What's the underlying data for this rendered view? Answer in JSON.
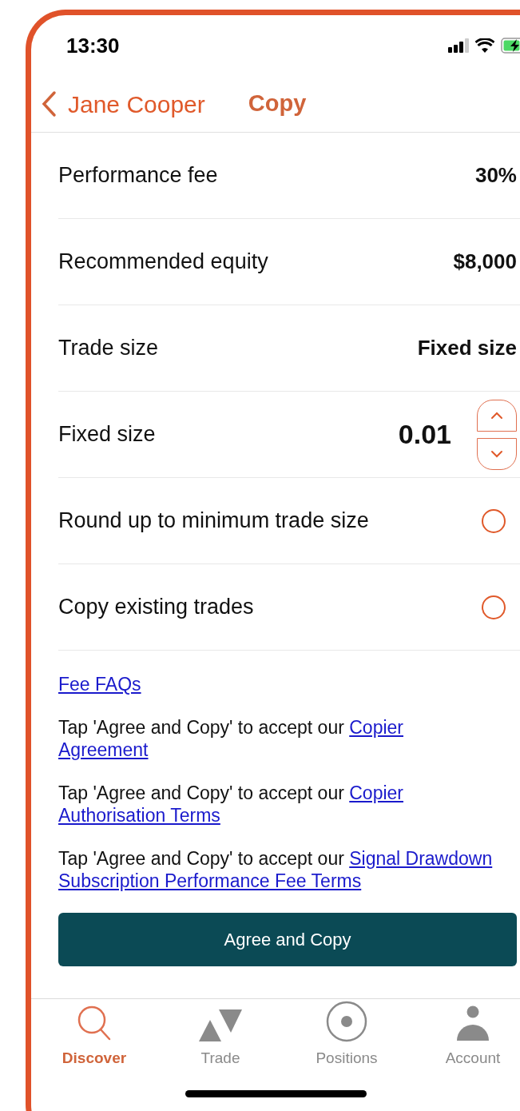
{
  "status_bar": {
    "time": "13:30"
  },
  "header": {
    "back_label": "Jane Cooper",
    "title": "Copy"
  },
  "rows": [
    {
      "kind": "value",
      "label": "Performance fee",
      "value": "30%"
    },
    {
      "kind": "value",
      "label": "Recommended equity",
      "value": "$8,000"
    },
    {
      "kind": "value",
      "label": "Trade size",
      "value": "Fixed size"
    },
    {
      "kind": "stepper",
      "label": "Fixed size",
      "value": "0.01"
    },
    {
      "kind": "radio",
      "label": "Round up to minimum trade size",
      "checked": false
    },
    {
      "kind": "radio",
      "label": "Copy existing trades",
      "checked": false
    }
  ],
  "fee_link": "Fee FAQs",
  "terms": [
    {
      "text": "Tap 'Agree and Copy' to accept our ",
      "link_lines": [
        "Copier",
        "Agreement"
      ]
    },
    {
      "text": "Tap 'Agree and Copy' to accept our ",
      "link_lines": [
        "Copier",
        "Authorisation Terms"
      ]
    },
    {
      "text": "Tap 'Agree and Copy' to accept our ",
      "link_lines": [
        "Signal Drawdown",
        "Subscription Performance Fee Terms"
      ]
    }
  ],
  "primary_button": "Agree and Copy",
  "tabs": [
    {
      "kind": "discover",
      "label": "Discover",
      "selected": true
    },
    {
      "kind": "trade",
      "label": "Trade",
      "selected": false
    },
    {
      "kind": "positions",
      "label": "Positions",
      "selected": false
    },
    {
      "kind": "account",
      "label": "Account",
      "selected": false
    }
  ]
}
